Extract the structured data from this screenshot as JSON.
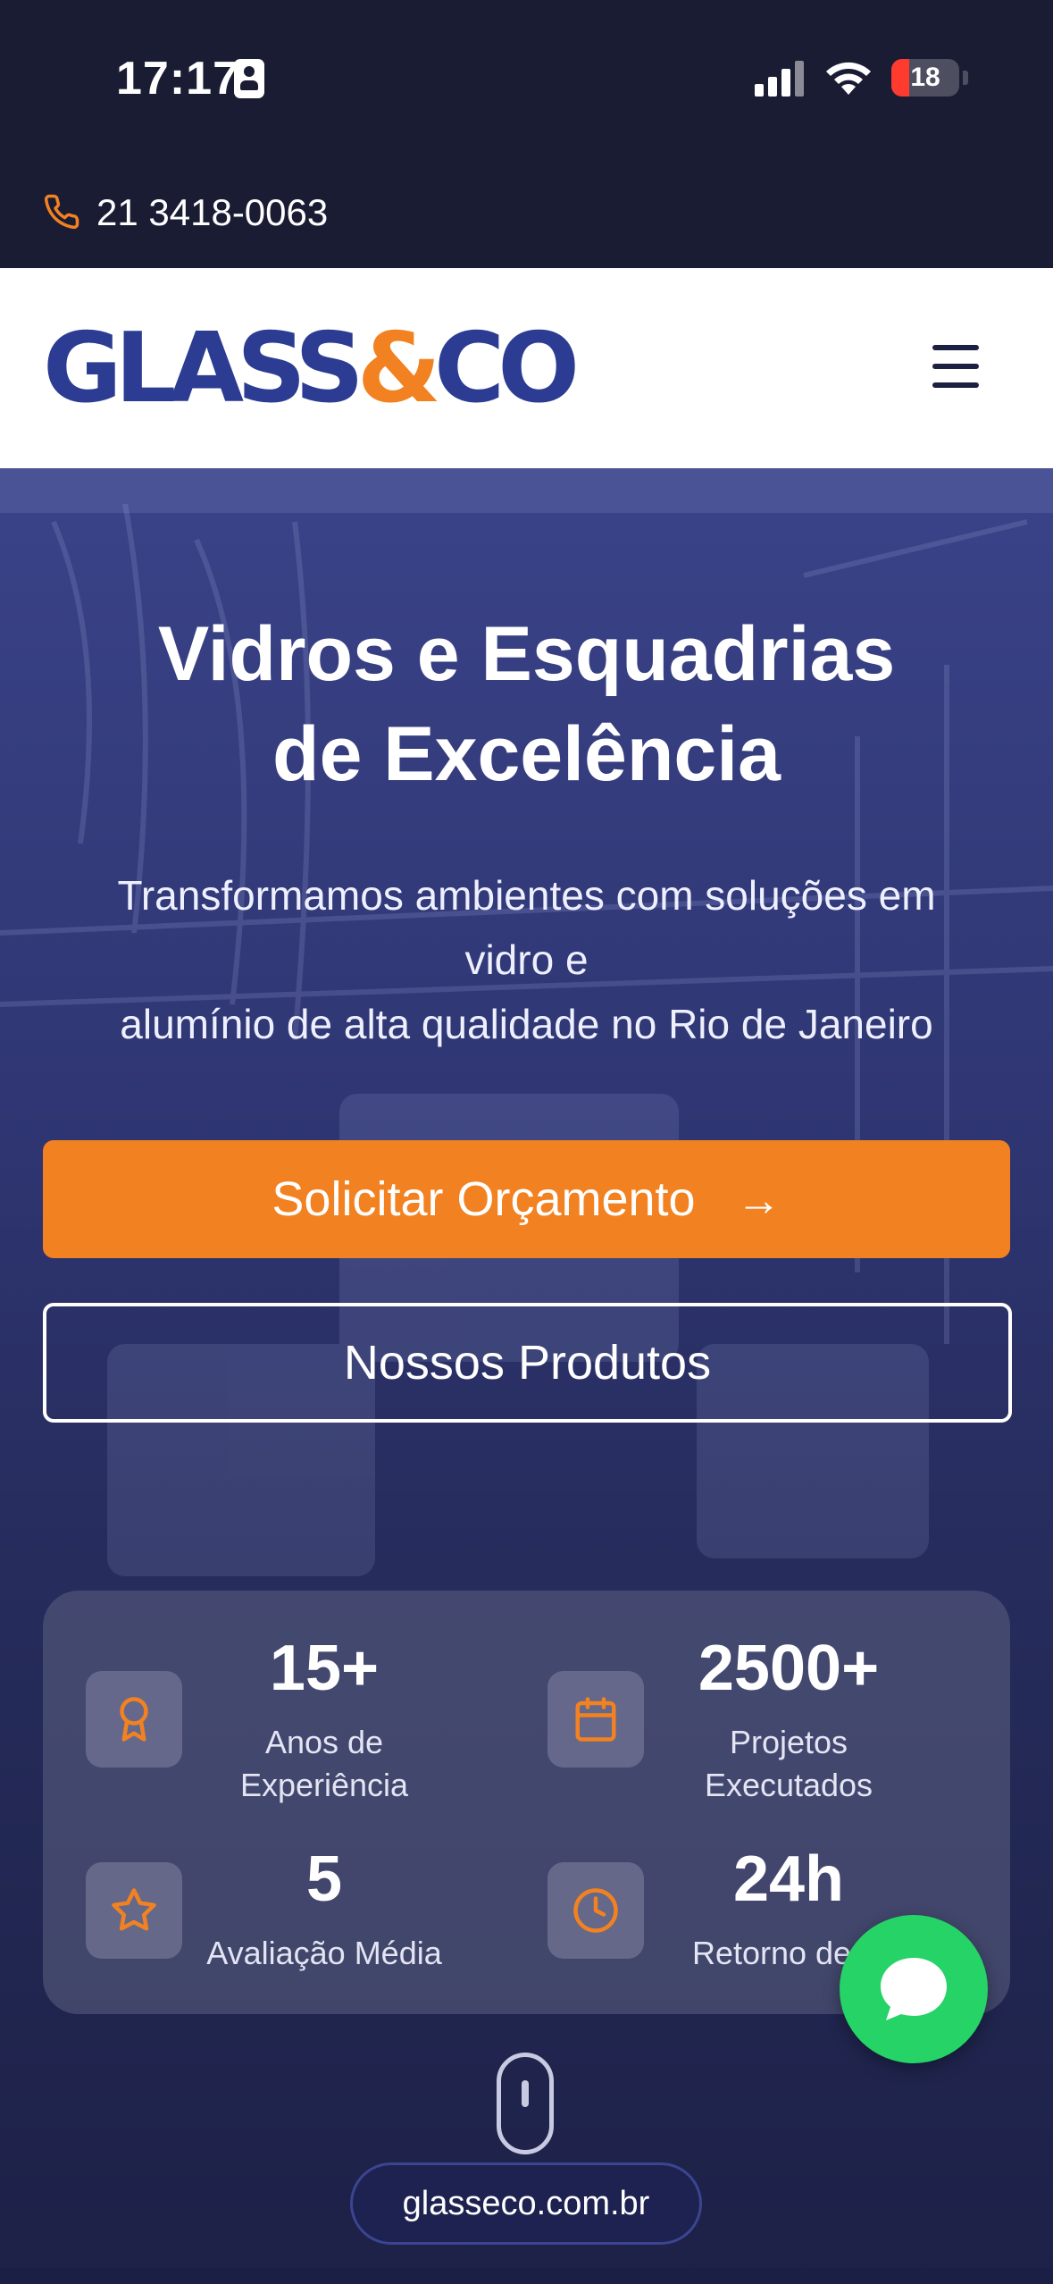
{
  "status_bar": {
    "time": "17:17",
    "battery_level": "18",
    "signal_icon": "cellular-signal-icon",
    "wifi_icon": "wifi-icon"
  },
  "topbar": {
    "phone_icon": "phone-icon",
    "phone_number": "21 3418-0063"
  },
  "header": {
    "logo_part1": "GLASS",
    "logo_amp": "&",
    "logo_part2": "CO",
    "menu_icon": "hamburger-menu-icon"
  },
  "hero": {
    "title_line1": "Vidros e Esquadrias",
    "title_line2": "de Excelência",
    "subtitle_line1": "Transformamos ambientes com soluções em",
    "subtitle_line2": "vidro e",
    "subtitle_line3": "alumínio de alta qualidade no Rio de Janeiro",
    "primary_button": "Solicitar Orçamento",
    "primary_button_icon": "arrow-right-icon",
    "secondary_button": "Nossos Produtos"
  },
  "stats": [
    {
      "icon": "award-ribbon-icon",
      "value": "15+",
      "label_line1": "Anos de",
      "label_line2": "Experiência"
    },
    {
      "icon": "calendar-icon",
      "value": "2500+",
      "label_line1": "Projetos",
      "label_line2": "Executados"
    },
    {
      "icon": "star-icon",
      "value": "5",
      "label_line1": "Avaliação Média",
      "label_line2": ""
    },
    {
      "icon": "clock-icon",
      "value": "24h",
      "label_line1": "Retorno de O",
      "label_line2": ""
    }
  ],
  "floating": {
    "whatsapp_icon": "whatsapp-chat-icon",
    "scroll_icon": "mouse-scroll-icon"
  },
  "browser": {
    "url": "glasseco.com.br"
  },
  "colors": {
    "accent": "#f28221",
    "brand_blue": "#2b3c92",
    "whatsapp_green": "#25d366",
    "dark_navy": "#1a1c33"
  }
}
